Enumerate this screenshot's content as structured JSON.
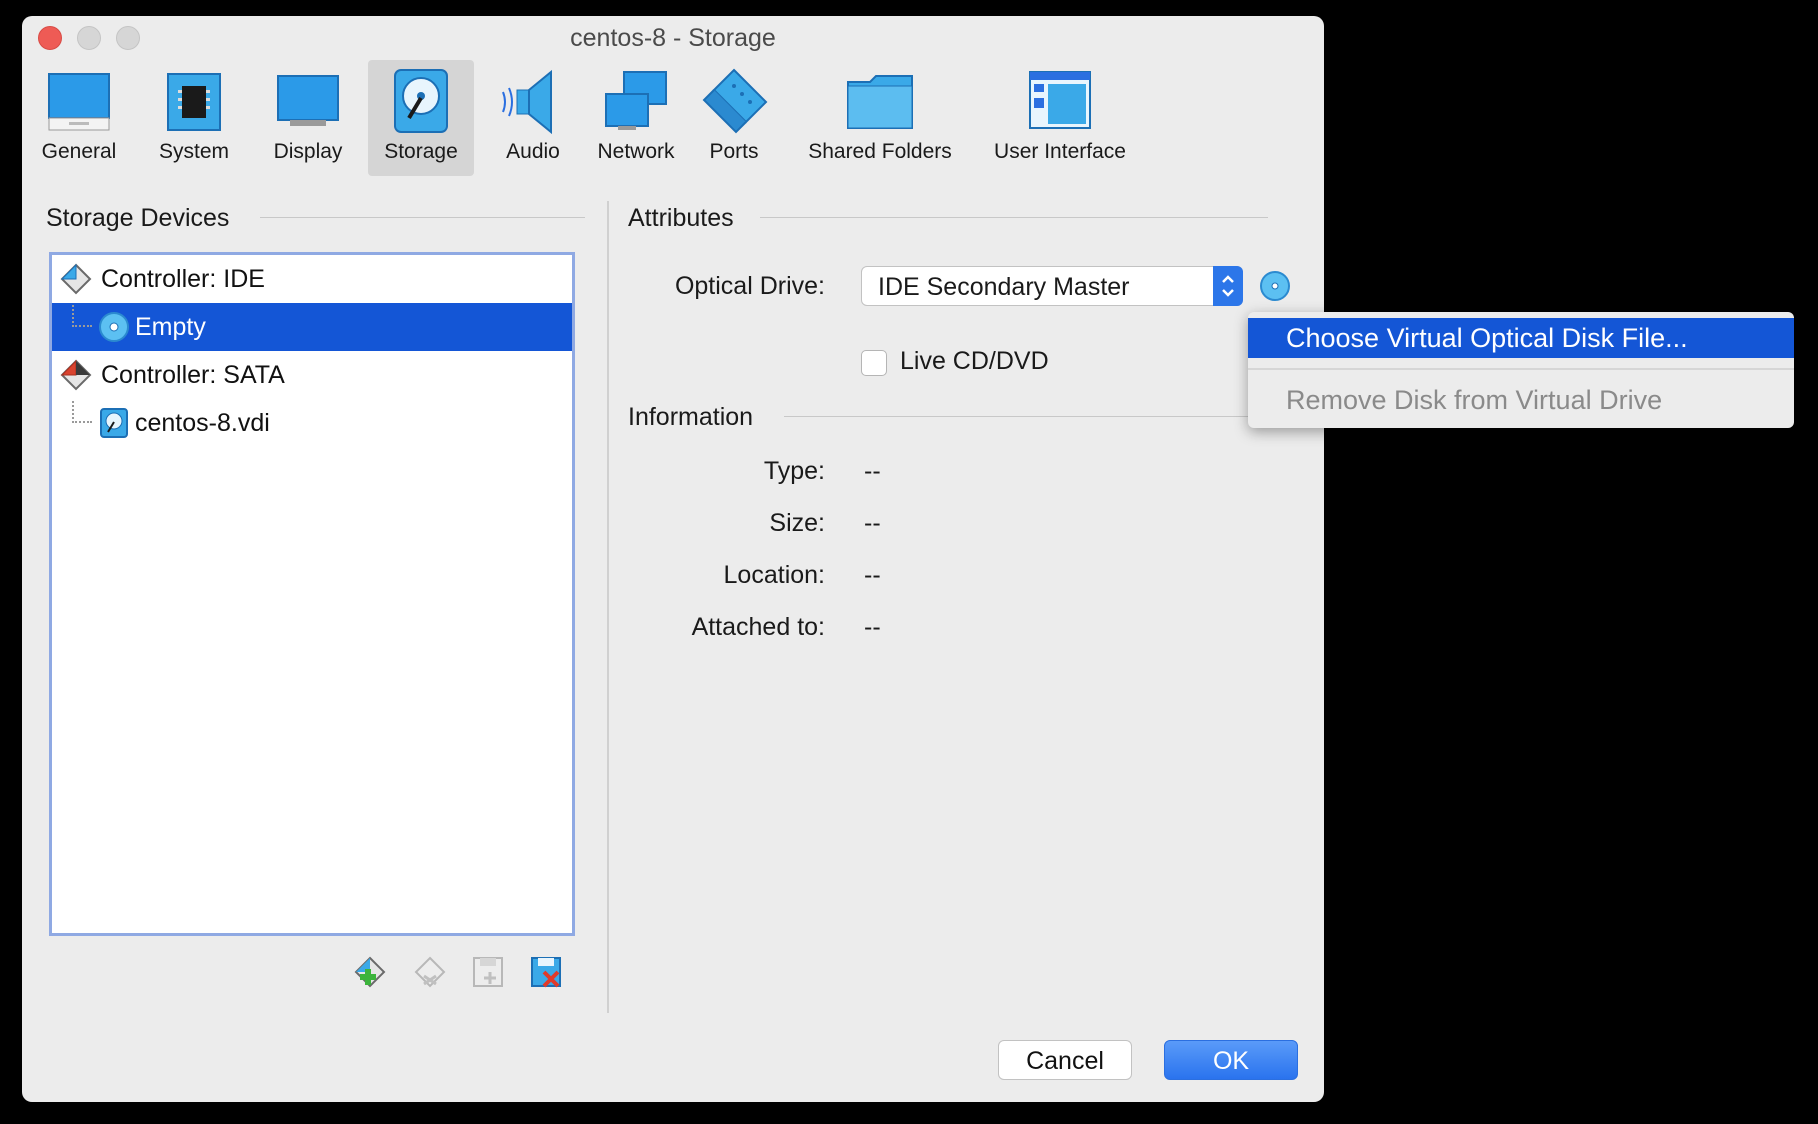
{
  "window": {
    "title": "centos-8 - Storage"
  },
  "toolbar": {
    "items": [
      {
        "label": "General",
        "icon": "monitor-icon"
      },
      {
        "label": "System",
        "icon": "chip-icon"
      },
      {
        "label": "Display",
        "icon": "display-icon"
      },
      {
        "label": "Storage",
        "icon": "hard-disk-icon",
        "active": true
      },
      {
        "label": "Audio",
        "icon": "speaker-icon"
      },
      {
        "label": "Network",
        "icon": "network-icon"
      },
      {
        "label": "Ports",
        "icon": "serial-port-icon"
      },
      {
        "label": "Shared Folders",
        "icon": "folder-icon"
      },
      {
        "label": "User Interface",
        "icon": "window-layout-icon"
      }
    ]
  },
  "storage": {
    "title": "Storage Devices",
    "tree": [
      {
        "label": "Controller: IDE",
        "icon": "ide-controller-icon"
      },
      {
        "label": "Empty",
        "icon": "optical-disc-icon",
        "selected": true
      },
      {
        "label": "Controller: SATA",
        "icon": "sata-controller-icon"
      },
      {
        "label": "centos-8.vdi",
        "icon": "hard-disk-icon"
      }
    ],
    "buttons": [
      "add-controller-icon",
      "remove-controller-icon",
      "add-attachment-icon",
      "remove-attachment-icon"
    ]
  },
  "attributes": {
    "title": "Attributes",
    "optical_drive_label": "Optical Drive:",
    "optical_drive_value": "IDE Secondary Master",
    "live_cd_label": "Live CD/DVD",
    "live_cd_checked": false
  },
  "information": {
    "title": "Information",
    "rows": [
      {
        "label": "Type:",
        "value": "--"
      },
      {
        "label": "Size:",
        "value": "--"
      },
      {
        "label": "Location:",
        "value": "--"
      },
      {
        "label": "Attached to:",
        "value": "--"
      }
    ]
  },
  "buttons": {
    "cancel": "Cancel",
    "ok": "OK"
  },
  "menu": {
    "items": [
      {
        "label": "Choose Virtual Optical Disk File...",
        "highlighted": true,
        "enabled": true
      },
      {
        "label": "Remove Disk from Virtual Drive",
        "highlighted": false,
        "enabled": false
      }
    ]
  },
  "colors": {
    "accent": "#1456d6",
    "icon_blue": "#3aa9e8",
    "close": "#ee5b55"
  }
}
